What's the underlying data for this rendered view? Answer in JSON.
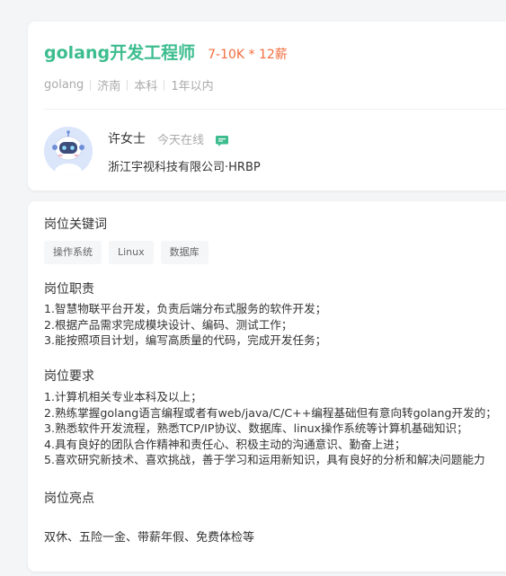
{
  "job": {
    "title": "golang开发工程师",
    "salary": "7-10K * 12薪",
    "tags": [
      "golang",
      "济南",
      "本科",
      "1年以内"
    ]
  },
  "recruiter": {
    "name": "许女士",
    "status": "今天在线",
    "company": "浙江宇视科技有限公司·HRBP"
  },
  "detail": {
    "keywords_title": "岗位关键词",
    "keywords": [
      "操作系统",
      "Linux",
      "数据库"
    ],
    "duties_title": "岗位职责",
    "duties": [
      "1.智慧物联平台开发，负责后端分布式服务的软件开发；",
      "2.根据产品需求完成模块设计、编码、测试工作；",
      "3.能按照项目计划，编写高质量的代码，完成开发任务；"
    ],
    "requirements_title": "岗位要求",
    "requirements": [
      "1.计算机相关专业本科及以上；",
      "2.熟练掌握golang语言编程或者有web/java/C/C++编程基础但有意向转golang开发的；",
      "3.熟悉软件开发流程，熟悉TCP/IP协议、数据库、linux操作系统等计算机基础知识；",
      "4.具有良好的团队合作精神和责任心、积极主动的沟通意识、勤奋上进；",
      "5.喜欢研究新技术、喜欢挑战，善于学习和运用新知识，具有良好的分析和解决问题能力"
    ],
    "highlights_title": "岗位亮点",
    "highlights": "双休、五险一金、带薪年假、免费体检等"
  },
  "colors": {
    "accent": "#3dbd8f",
    "salary": "#f26d3d"
  },
  "icons": {
    "chat": "chat-icon",
    "avatar": "robot-avatar"
  }
}
